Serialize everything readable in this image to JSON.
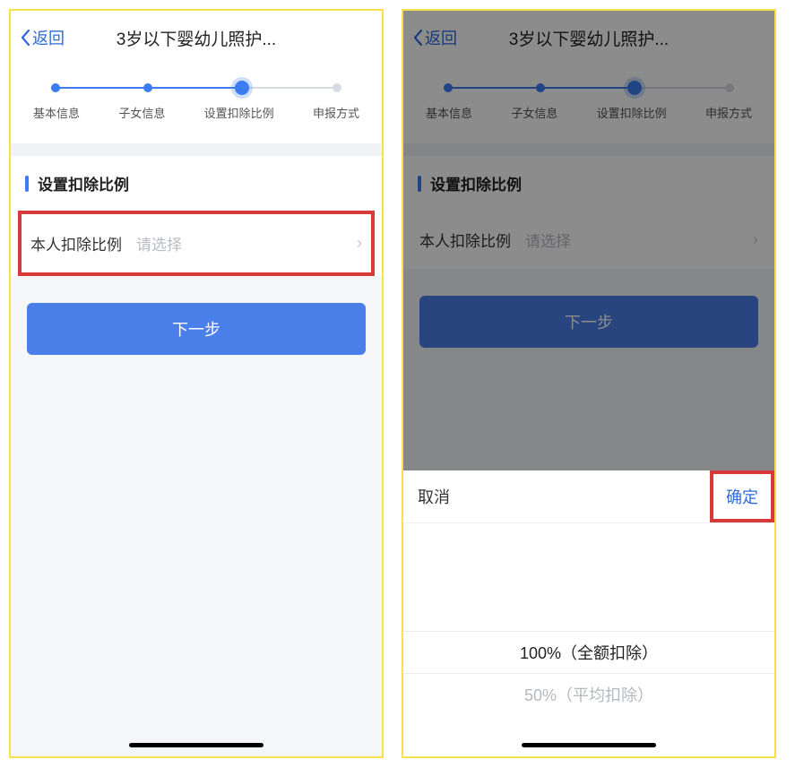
{
  "nav": {
    "back": "返回",
    "title": "3岁以下婴幼儿照护..."
  },
  "steps": [
    "基本信息",
    "子女信息",
    "设置扣除比例",
    "申报方式"
  ],
  "section_title": "设置扣除比例",
  "field": {
    "label": "本人扣除比例",
    "placeholder": "请选择"
  },
  "next_button": "下一步",
  "picker": {
    "cancel": "取消",
    "confirm": "确定",
    "options": [
      "100%（全额扣除）",
      "50%（平均扣除）"
    ]
  }
}
